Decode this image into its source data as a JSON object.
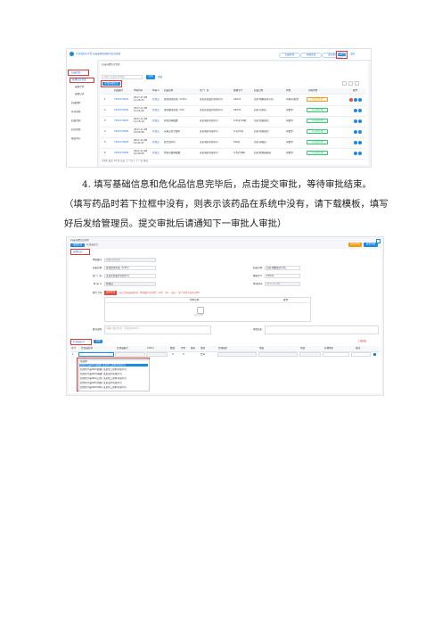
{
  "shot1": {
    "header": {
      "brand": "全药源药房平台 药品采购管理服务信息系统",
      "actions": [
        "药品管理",
        "采购管理",
        "消息通知",
        "退出"
      ]
    },
    "sidebar": {
      "title": "菜单导航",
      "items": [
        "药品管理",
        "基础信息管理",
        "采购计划",
        "采购记录",
        "药品维护",
        "库存管理",
        "质量管理",
        "药房管理",
        "报表中心"
      ]
    },
    "tab": "药品基础信息管理",
    "search": {
      "placeholder": "请输入药品名称/编码",
      "query_label": "查询",
      "reset_label": "重置"
    },
    "add_button": "新增基础信息",
    "columns": [
      "",
      "药品编号",
      "申请时间",
      "申请人",
      "药品名称",
      "生产厂家",
      "规格型号",
      "药品分类",
      "状态",
      "审核状态",
      "操作"
    ],
    "rows": [
      {
        "no": "1",
        "code": "YP20170901",
        "time": "2017-11-08 11:26:33",
        "person": "管理员",
        "name": "氯化钠注射液（0.9%）",
        "maker": "某某药业股份有限公司",
        "spec": "100ml",
        "cat": "西药-电解质调节药",
        "state": "草稿/待提交",
        "audit": "待提交审批",
        "ops": 3
      },
      {
        "no": "2",
        "code": "YP20170902",
        "time": "2017-11-08 11:24:40",
        "person": "管理员",
        "name": "葡萄糖注射液（5%）",
        "maker": "某某药业股份有限公司",
        "spec": "250ml",
        "cat": "西药-营养药",
        "state": "审批中",
        "audit": "待审核审批",
        "ops": 2
      },
      {
        "no": "3",
        "code": "YP20170903",
        "time": "2017-11-08 11:15:10",
        "person": "管理员",
        "name": "阿莫西林胶囊",
        "maker": "某某制药有限公司",
        "spec": "0.25g*24粒",
        "cat": "西药-抗感染药",
        "state": "审批中",
        "audit": "待审核审批",
        "ops": 2
      },
      {
        "no": "4",
        "code": "YP20170904",
        "time": "2017-11-08 10:52:06",
        "person": "管理员",
        "name": "头孢克肟分散片",
        "maker": "某某制药有限公司",
        "spec": "0.1g*6片",
        "cat": "西药-抗感染药",
        "state": "审批中",
        "audit": "待审核审批",
        "ops": 2
      },
      {
        "no": "5",
        "code": "YP20170905",
        "time": "2017-11-08 10:41:27",
        "person": "管理员",
        "name": "复方甘草片",
        "maker": "某某制药有限公司",
        "spec": "100片",
        "cat": "西药-镇咳药",
        "state": "审批中",
        "audit": "待审核审批",
        "ops": 2
      },
      {
        "no": "6",
        "code": "YP20170906",
        "time": "2017-11-08 10:30:55",
        "person": "管理员",
        "name": "布洛芬缓释胶囊",
        "maker": "某某制药有限公司",
        "spec": "0.3g*20粒",
        "cat": "西药-解热镇痛药",
        "state": "审批中",
        "audit": "待审核审批",
        "ops": 2
      }
    ],
    "pager": "共6条  每页 10 条  首页 上一页 1 下一页 末页"
  },
  "caption": {
    "line1": "4. 填写基础信息和危化品信息完毕后，点击提交审批，等待审批结束。",
    "line2": "（填写药品时若下拉框中没有，则表示该药品在系统中没有，请下载模板，填写",
    "line3": "好后发给管理员。提交审批后请通知下一审批人审批）"
  },
  "shot2": {
    "title": "药品基础信息新增",
    "tabs": [
      "基础信息",
      "危化品信息"
    ],
    "save_label": "保存草稿",
    "submit_label": "提交审批",
    "section1": "基础信息",
    "fields_left": [
      {
        "label": "单据编号:",
        "value": "系统自动生成"
      },
      {
        "label": "药品名称:",
        "value": "氯化钠注射液（0.9%）"
      },
      {
        "label": "生产厂家:",
        "value": "某某药业股份有限公司"
      },
      {
        "label": "申 请 人:",
        "value": "管理员"
      }
    ],
    "fields_right": [
      {
        "label": "药品分类:",
        "value": "西药-电解质调节药"
      },
      {
        "label": "规格型号:",
        "value": "100ml"
      },
      {
        "label": "申请时间:",
        "value": "2017-11-08"
      }
    ],
    "attach_label": "附件上传:",
    "upload_label": "选择文件",
    "upload_hint": "请上传药品说明书、检测报告等文件（pdf、doc、jpg），单个文件不超过10M",
    "attach_cols": [
      "附件名称",
      "操作"
    ],
    "empty_text": "暂无附件",
    "remark_label": "备注说明:",
    "remark_placeholder": "请输入备注信息（不超过200字）",
    "reviewer_label": "审批意见:",
    "section2": "危化品信息",
    "add_row_label": "添加",
    "download_label": "下载模板",
    "grid_cols": [
      "序号",
      "危化品名称",
      "危化品编号",
      "CAS号",
      "数量",
      "单位",
      "储存",
      "类别",
      "管理级别",
      "浓度",
      "用途",
      "存放地点",
      "备注"
    ],
    "grid_row": {
      "idx": "1",
      "qty": "0",
      "unit": "0",
      "store": "仓库"
    },
    "dropdown_header": "请选择",
    "dropdown_items": [
      "危险化学品001(硫酸) 某某化工原料有限公司",
      "危险化学品002(盐酸) 某某化工原料有限公司",
      "危险化学品003(硝酸) 某某试剂有限公司",
      "危险化学品004(乙醇) 某某化工原料有限公司",
      "危险化学品005(丙酮) 某某试剂有限公司",
      "危险化学品006(甲醇) 某某化工原料有限公司"
    ]
  }
}
